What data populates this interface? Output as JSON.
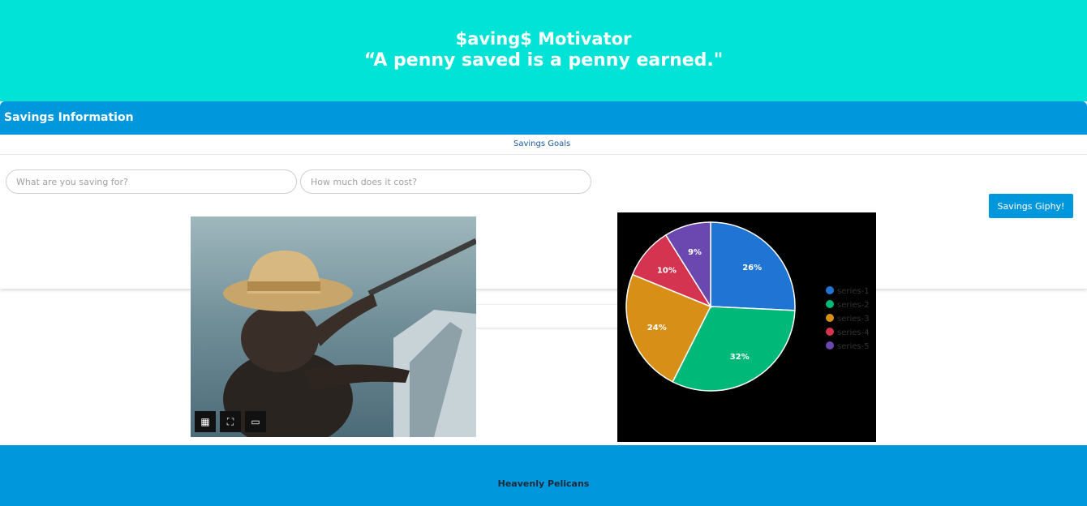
{
  "header": {
    "title": "$aving$ Motivator",
    "quote": "“A penny saved is a penny earned.\""
  },
  "card": {
    "title": "Savings Information",
    "tab_label": "Savings Goals",
    "goal_input": {
      "placeholder": "What are you saving for?",
      "value": ""
    },
    "cost_input": {
      "placeholder": "How much does it cost?",
      "value": ""
    },
    "giphy_button": "Savings Giphy!"
  },
  "gif": {
    "controls": [
      {
        "icon": "grid-icon",
        "glyph": "▦"
      },
      {
        "icon": "fullscreen-icon",
        "glyph": "⛶"
      },
      {
        "icon": "tv-icon",
        "glyph": "📺"
      }
    ]
  },
  "chart_data": {
    "type": "pie",
    "title": "",
    "legend_position": "right",
    "series": [
      {
        "name": "series-1",
        "value": 26,
        "label": "26%",
        "color": "#1f74d4"
      },
      {
        "name": "series-2",
        "value": 32,
        "label": "32%",
        "color": "#00b877"
      },
      {
        "name": "series-3",
        "value": 24,
        "label": "24%",
        "color": "#d78f17"
      },
      {
        "name": "series-4",
        "value": 10,
        "label": "10%",
        "color": "#d4344f"
      },
      {
        "name": "series-5",
        "value": 9,
        "label": "9%",
        "color": "#6a48b0"
      }
    ]
  },
  "footer": {
    "text": "Heavenly Pelicans"
  },
  "colors": {
    "header_bg": "#00e3d6",
    "accent": "#0097dc",
    "chart_bg": "#000000"
  }
}
